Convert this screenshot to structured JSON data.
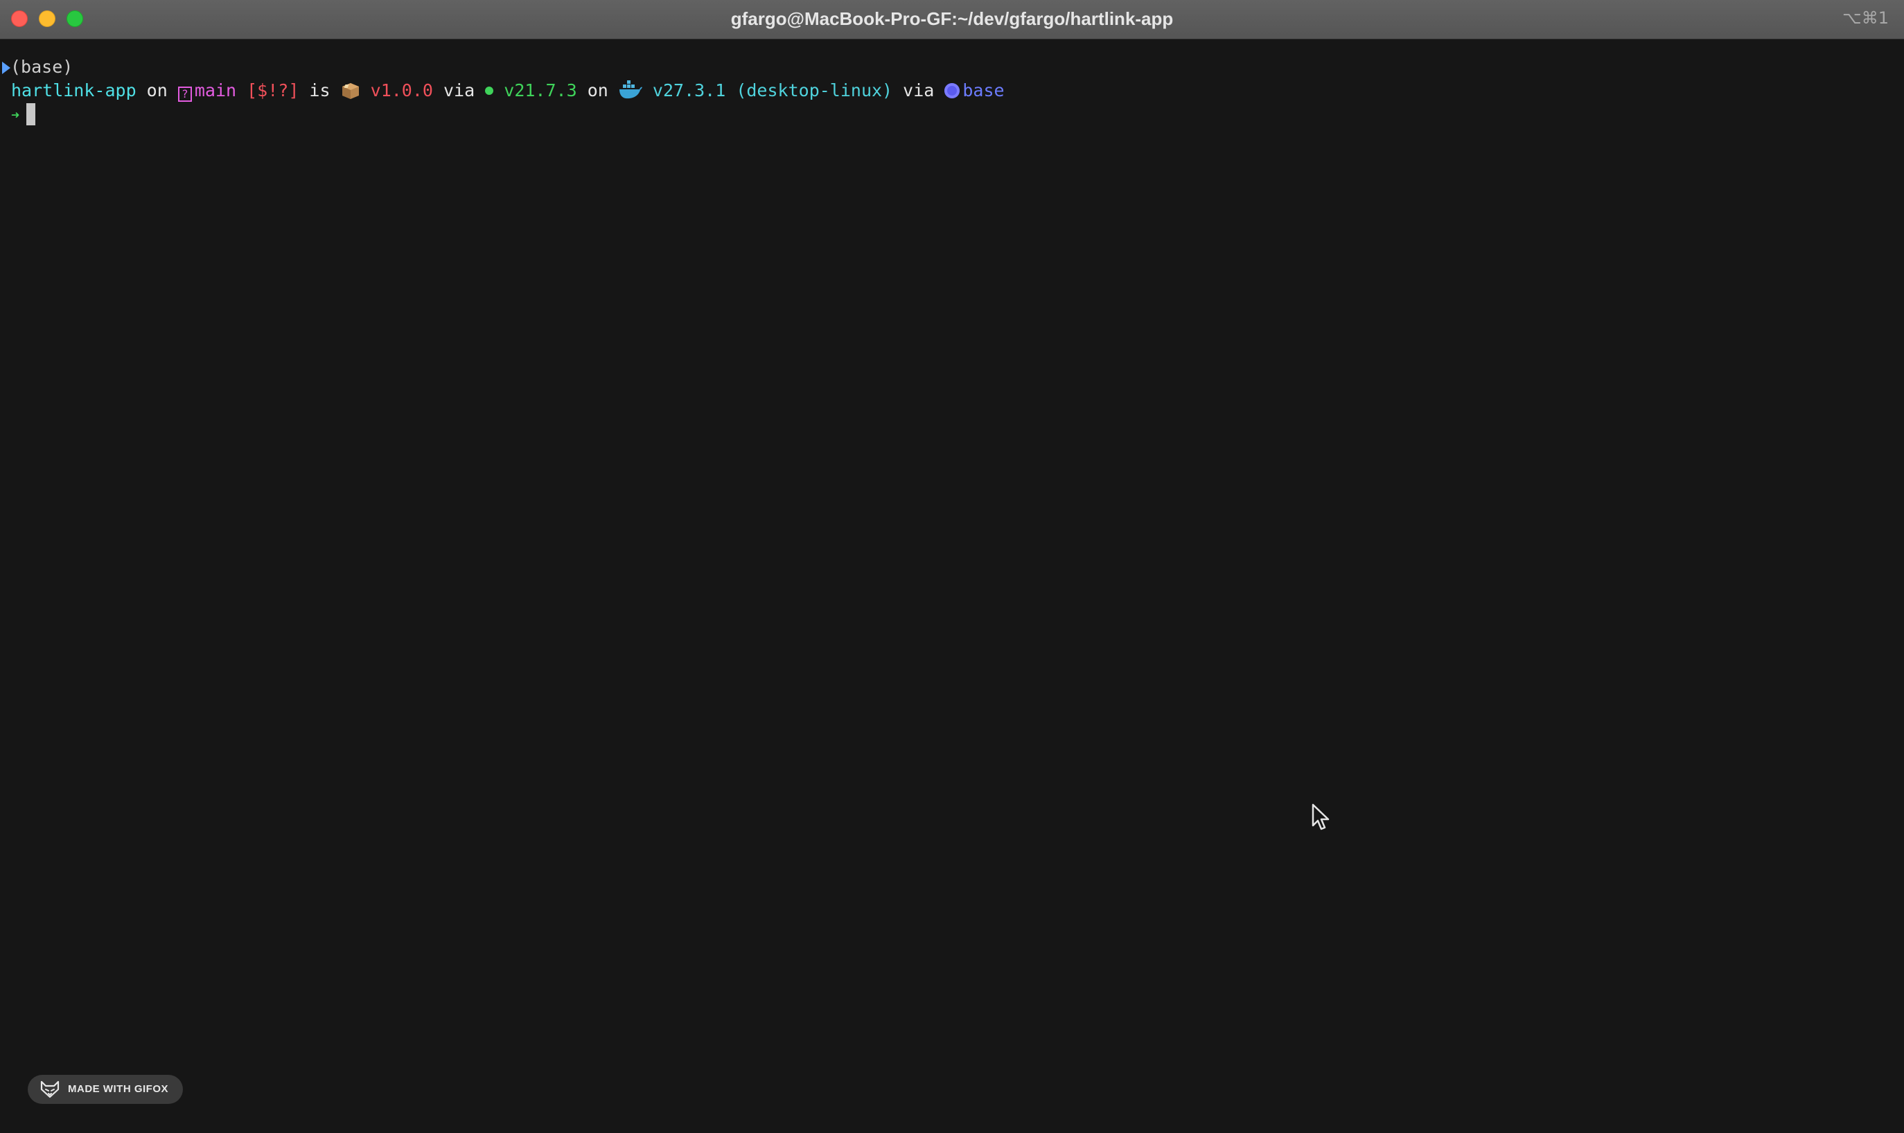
{
  "window": {
    "title": "gfargo@MacBook-Pro-GF:~/dev/gfargo/hartlink-app",
    "shortcut": "⌥⌘1",
    "buttons": [
      "close",
      "minimize",
      "zoom"
    ]
  },
  "terminal": {
    "env_line": "(base)",
    "prompt": {
      "directory": "hartlink-app",
      "on_1": " on ",
      "branch_icon": "?",
      "branch": "main",
      "git_status": " [$!?]",
      "is": " is ",
      "package_version": " v1.0.0",
      "via_1": " via ",
      "node_version": " v21.7.3",
      "on_2": " on ",
      "docker_version": " v27.3.1",
      "docker_context": " (desktop-linux)",
      "via_2": " via ",
      "conda_env": "base"
    },
    "input_symbol": "➜",
    "input_value": ""
  },
  "badge": {
    "label": "MADE WITH GIFOX"
  },
  "icons": {
    "env_marker": "triangle-right-icon",
    "package": "package-box-icon",
    "node": "node-dot-icon",
    "docker": "docker-whale-icon",
    "conda": "conda-circle-icon",
    "badge": "fox-icon",
    "pointer": "mouse-pointer-icon"
  },
  "colors": {
    "background": "#161616",
    "directory": "#4fe0e6",
    "branch": "#e35ce0",
    "git_status": "#f0505a",
    "package_version": "#f0505a",
    "node_version": "#3fd35a",
    "docker_version": "#4fd2dc",
    "conda_env": "#6c7cff"
  }
}
